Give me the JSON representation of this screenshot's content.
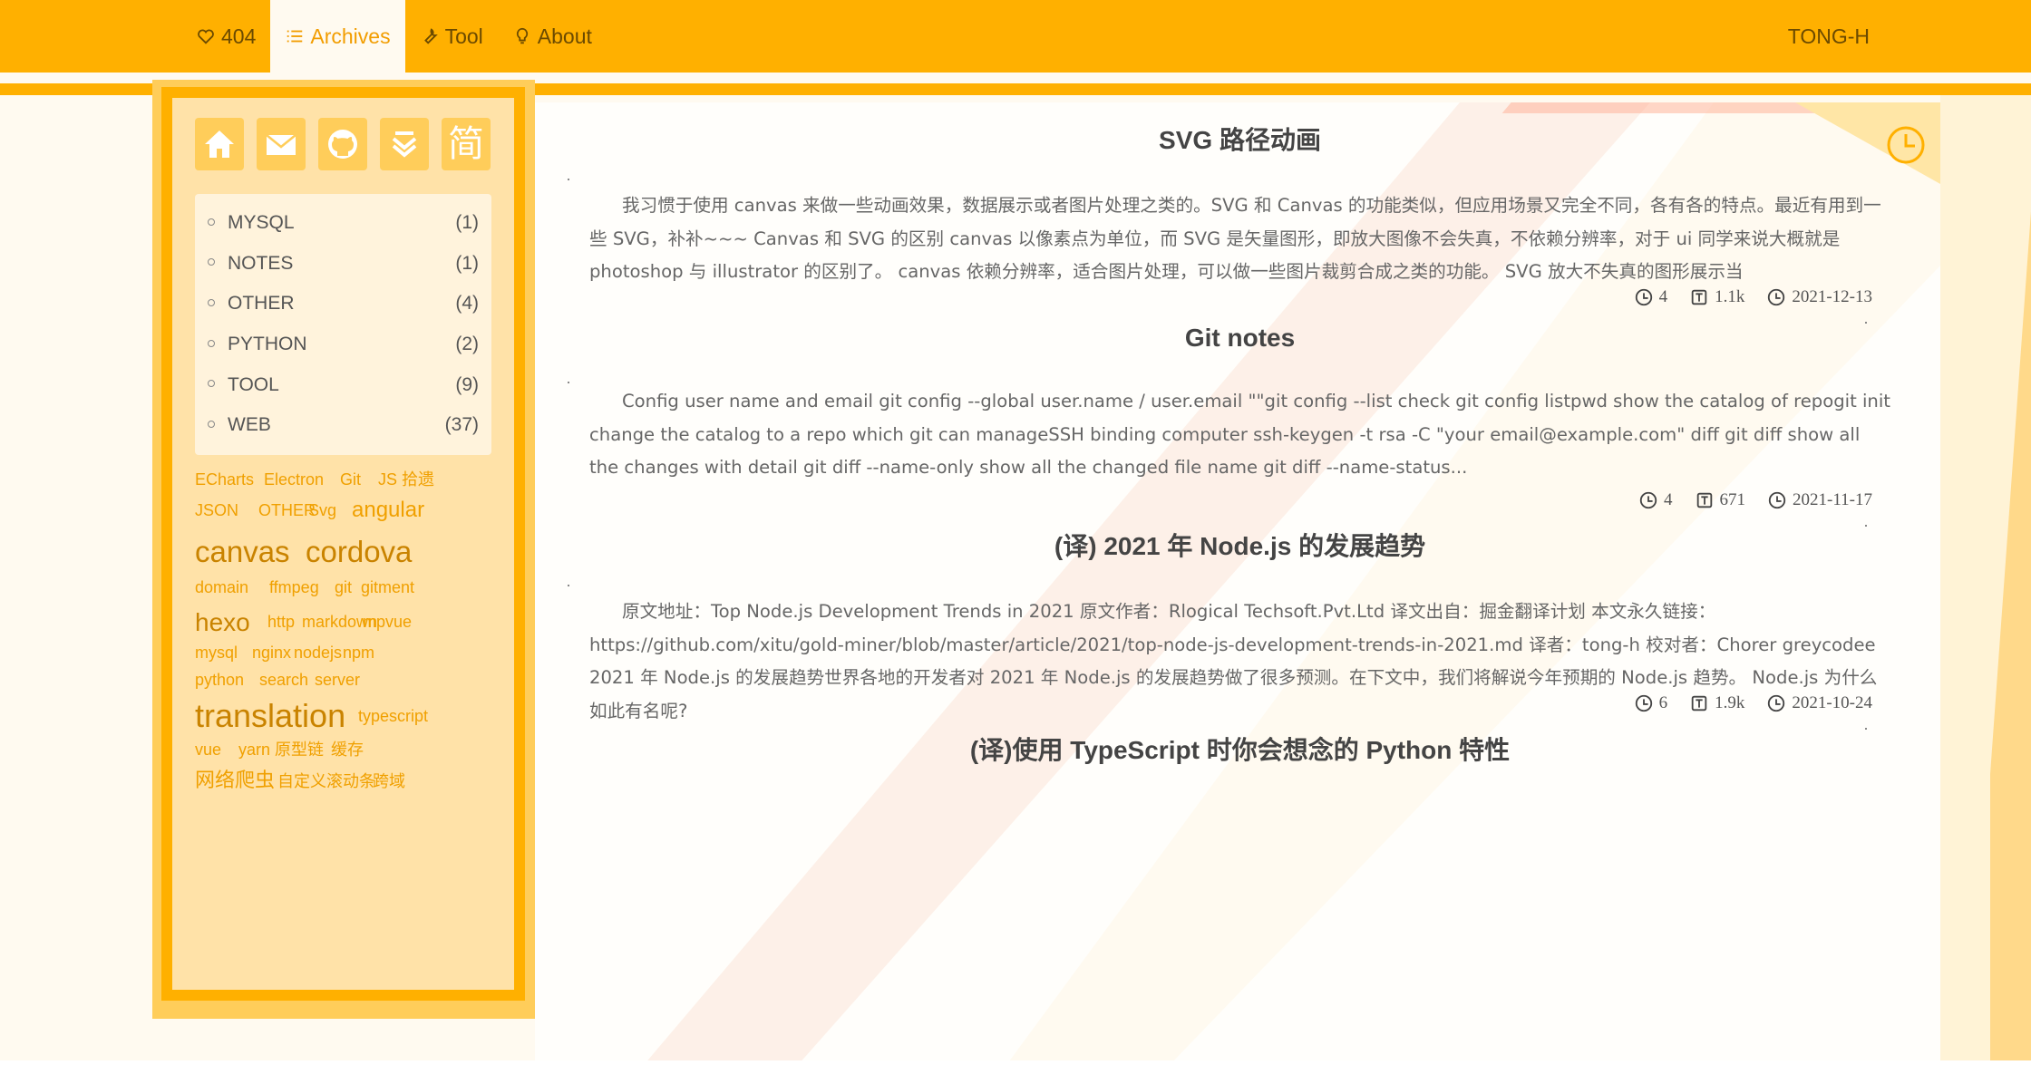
{
  "nav": {
    "items": [
      {
        "label": "404",
        "icon": "heart-icon"
      },
      {
        "label": "Archives",
        "icon": "list-icon"
      },
      {
        "label": "Tool",
        "icon": "wrench-icon"
      },
      {
        "label": "About",
        "icon": "bulb-icon"
      }
    ],
    "brand": "TONG-H"
  },
  "sidebar": {
    "social": [
      {
        "icon": "home-icon"
      },
      {
        "icon": "mail-icon"
      },
      {
        "icon": "github-icon"
      },
      {
        "icon": "stack-icon"
      },
      {
        "icon": "jianshu-icon",
        "text": "简"
      }
    ],
    "categories": [
      {
        "name": "MYSQL",
        "count": "(1)"
      },
      {
        "name": "NOTES",
        "count": "(1)"
      },
      {
        "name": "OTHER",
        "count": "(4)"
      },
      {
        "name": "PYTHON",
        "count": "(2)"
      },
      {
        "name": "TOOL",
        "count": "(9)"
      },
      {
        "name": "WEB",
        "count": "(37)"
      }
    ],
    "tags": [
      "ECharts",
      "Electron",
      "Git",
      "JS 拾遗",
      "JSON",
      "OTHER",
      "Svg",
      "angular",
      "canvas",
      "cordova",
      "domain",
      "ffmpeg",
      "git",
      "gitment",
      "hexo",
      "http",
      "markdown",
      "mpvue",
      "mysql",
      "nginx",
      "nodejs",
      "npm",
      "python",
      "search",
      "server",
      "translation",
      "typescript",
      "vue",
      "yarn",
      "原型链",
      "缓存",
      "网络爬虫",
      "自定义滚动条",
      "跨域"
    ]
  },
  "posts": [
    {
      "title": "SVG 路径动画",
      "excerpt": "我习惯于使用 canvas 来做一些动画效果，数据展示或者图片处理之类的。SVG 和 Canvas 的功能类似，但应用场景又完全不同，各有各的特点。最近有用到一些 SVG，补补~~~ Canvas 和 SVG 的区别 canvas 以像素点为单位，而 SVG 是矢量图形，即放大图像不会失真，不依赖分辨率，对于 ui 同学来说大概就是 photoshop 与 illustrator 的区别了。 canvas 依赖分辨率，适合图片处理，可以做一些图片裁剪合成之类的功能。 SVG 放大不失真的图形展示当",
      "read_time": "4",
      "words": "1.1k",
      "date": "2021-12-13"
    },
    {
      "title": "Git notes",
      "excerpt": "Config user name and email git config  --global user.name / user.email \"\"git config --list check git config listpwd show the catalog of repogit init change the catalog to a repo which git can manageSSH binding computer ssh-keygen -t rsa -C \"your email@example.com\" diff git diff show all the changes with detail git diff --name-only show all the changed file name git diff --name-status...",
      "read_time": "4",
      "words": "671",
      "date": "2021-11-17"
    },
    {
      "title": "(译) 2021 年 Node.js 的发展趋势",
      "excerpt": "原文地址：Top Node.js Development Trends in 2021 原文作者：Rlogical Techsoft.Pvt.Ltd 译文出自：掘金翻译计划 本文永久链接：https://github.com/xitu/gold-miner/blob/master/article/2021/top-node-js-development-trends-in-2021.md 译者：tong-h 校对者：Chorer greycodee 2021 年 Node.js 的发展趋势世界各地的开发者对 2021 年 Node.js 的发展趋势做了很多预测。在下文中，我们将解说今年预期的 Node.js 趋势。 Node.js 为什么如此有名呢?",
      "read_time": "6",
      "words": "1.9k",
      "date": "2021-10-24"
    },
    {
      "title": "(译)使用 TypeScript 时你会想念的 Python 特性"
    }
  ],
  "colors": {
    "accent": "#ffb000",
    "tag": "#f0a000",
    "sidebar_bg": "#ffe2a8"
  }
}
